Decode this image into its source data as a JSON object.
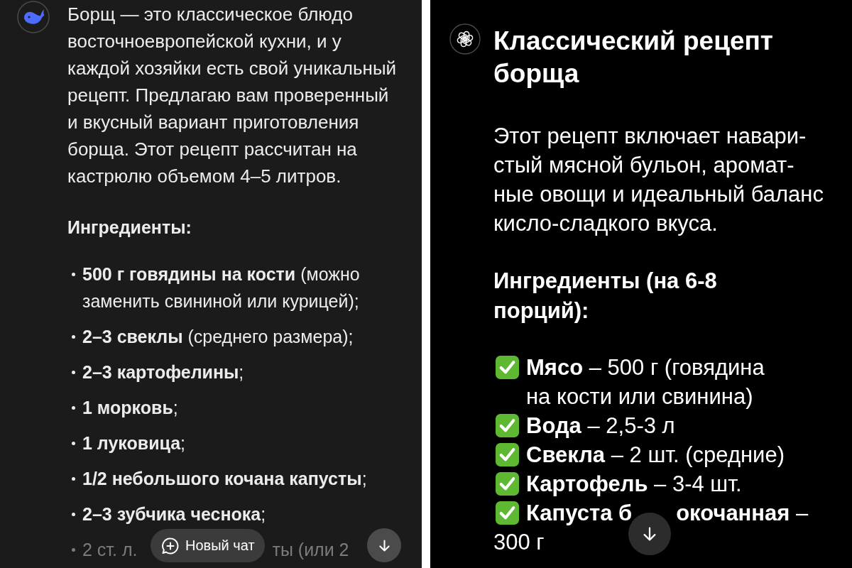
{
  "left_chat": {
    "paragraph": "Борщ — это классическое блюдо восточноевропейской кухни, и у каждой хозяйки есть свой уникальный рецепт. Предлагаю вам проверенный и вкусный вариант приготовления борща. Этот рецепт рассчитан на кастрюлю объемом 4–5 литров.",
    "heading": "Ингредиенты:",
    "ingredients": [
      {
        "kind": "full",
        "text": "**500 г говядины на кости** (можно заменить свининой или курицей);",
        "faded": false
      },
      {
        "kind": "full",
        "text": "**2–3 свеклы** (среднего размера);",
        "faded": false
      },
      {
        "kind": "full",
        "text": "**2–3 картофелины**;",
        "faded": false
      },
      {
        "kind": "full",
        "text": "**1 морковь**;",
        "faded": false
      },
      {
        "kind": "full",
        "text": "**1 луковица**;",
        "faded": false
      },
      {
        "kind": "full",
        "text": "**1/2 небольшого кочана капусты**;",
        "faded": false
      },
      {
        "kind": "full",
        "text": "**2–3 зубчика чеснока**;",
        "faded": false
      },
      {
        "kind": "covered",
        "text": "2 ст. л.",
        "text_after_cover": "ты (или 2",
        "faded": true
      }
    ],
    "new_chat_button": {
      "label": "Новый чат"
    }
  },
  "right_chat": {
    "title": "Классический рецепт борща",
    "paragraph": "Этот рецепт включает навари-стый мясной бульон, аромат-ные овощи и идеальный баланс кисло-сладкого вкуса.",
    "heading": "Ингредиенты (на 6-8 порций):",
    "ingredients": [
      {
        "kind": "full",
        "name": "Мясо",
        "amount": "– 500 г (говядина на кости или свинина)"
      },
      {
        "kind": "full",
        "name": "Вода",
        "amount": "– 2,5-3 л"
      },
      {
        "kind": "full",
        "name": "Свекла",
        "amount": "– 2 шт. (средние)"
      },
      {
        "kind": "full",
        "name": "Картофель",
        "amount": "– 3-4 шт."
      },
      {
        "kind": "covered",
        "name": "Капуста б",
        "name_after_cover": "окочанная",
        "amount_end": "–",
        "amount_next_line": "300 г"
      }
    ]
  }
}
